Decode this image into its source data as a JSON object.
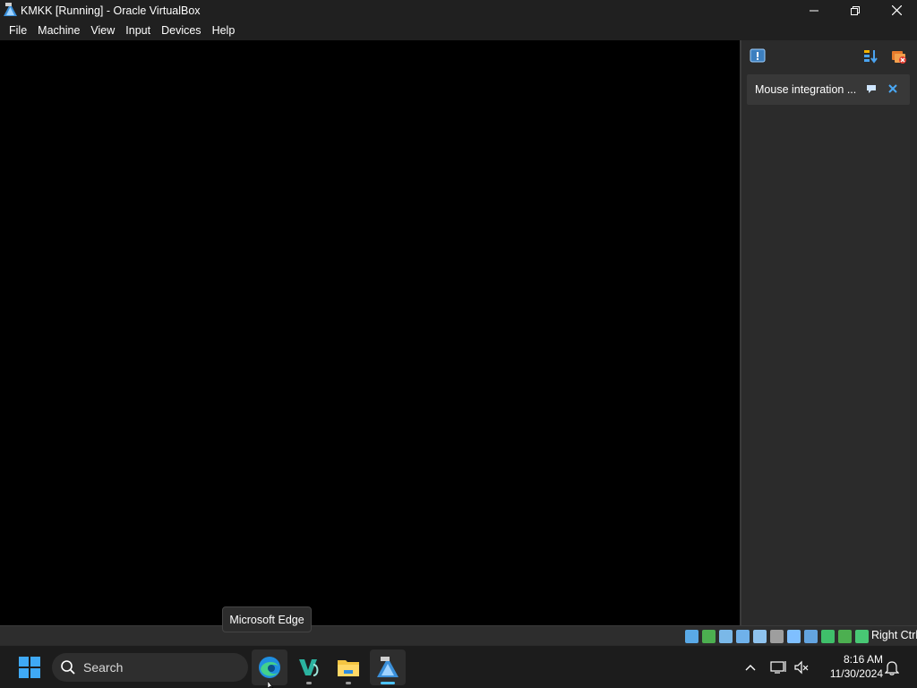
{
  "window": {
    "title": "KMKK [Running] - Oracle VirtualBox"
  },
  "menubar": {
    "items": [
      "File",
      "Machine",
      "View",
      "Input",
      "Devices",
      "Help"
    ]
  },
  "side_panel": {
    "notification": {
      "text": "Mouse integration ..."
    }
  },
  "statusbar": {
    "host_key": "Right Ctrl",
    "icons": [
      {
        "name": "hard-disk-icon",
        "color": "#5aa9e6"
      },
      {
        "name": "optical-drive-icon",
        "color": "#4caf50"
      },
      {
        "name": "audio-icon",
        "color": "#7ab8e8"
      },
      {
        "name": "network-icon",
        "color": "#6fb1ea"
      },
      {
        "name": "usb-icon",
        "color": "#8fc3ee"
      },
      {
        "name": "shared-folders-icon",
        "color": "#9e9e9e"
      },
      {
        "name": "display-icon",
        "color": "#7fbfff"
      },
      {
        "name": "recording-icon",
        "color": "#63a4e0"
      },
      {
        "name": "cpu-icon",
        "color": "#3fbf6a"
      },
      {
        "name": "mouse-integration-icon",
        "color": "#4caf50"
      },
      {
        "name": "keyboard-icon",
        "color": "#48c774"
      }
    ]
  },
  "tooltip": {
    "text": "Microsoft Edge"
  },
  "taskbar": {
    "search_placeholder": "Search",
    "apps": [
      "microsoft-edge",
      "visual-studio",
      "file-explorer",
      "virtualbox"
    ]
  },
  "clock": {
    "time": "8:16 AM",
    "date": "11/30/2024"
  }
}
